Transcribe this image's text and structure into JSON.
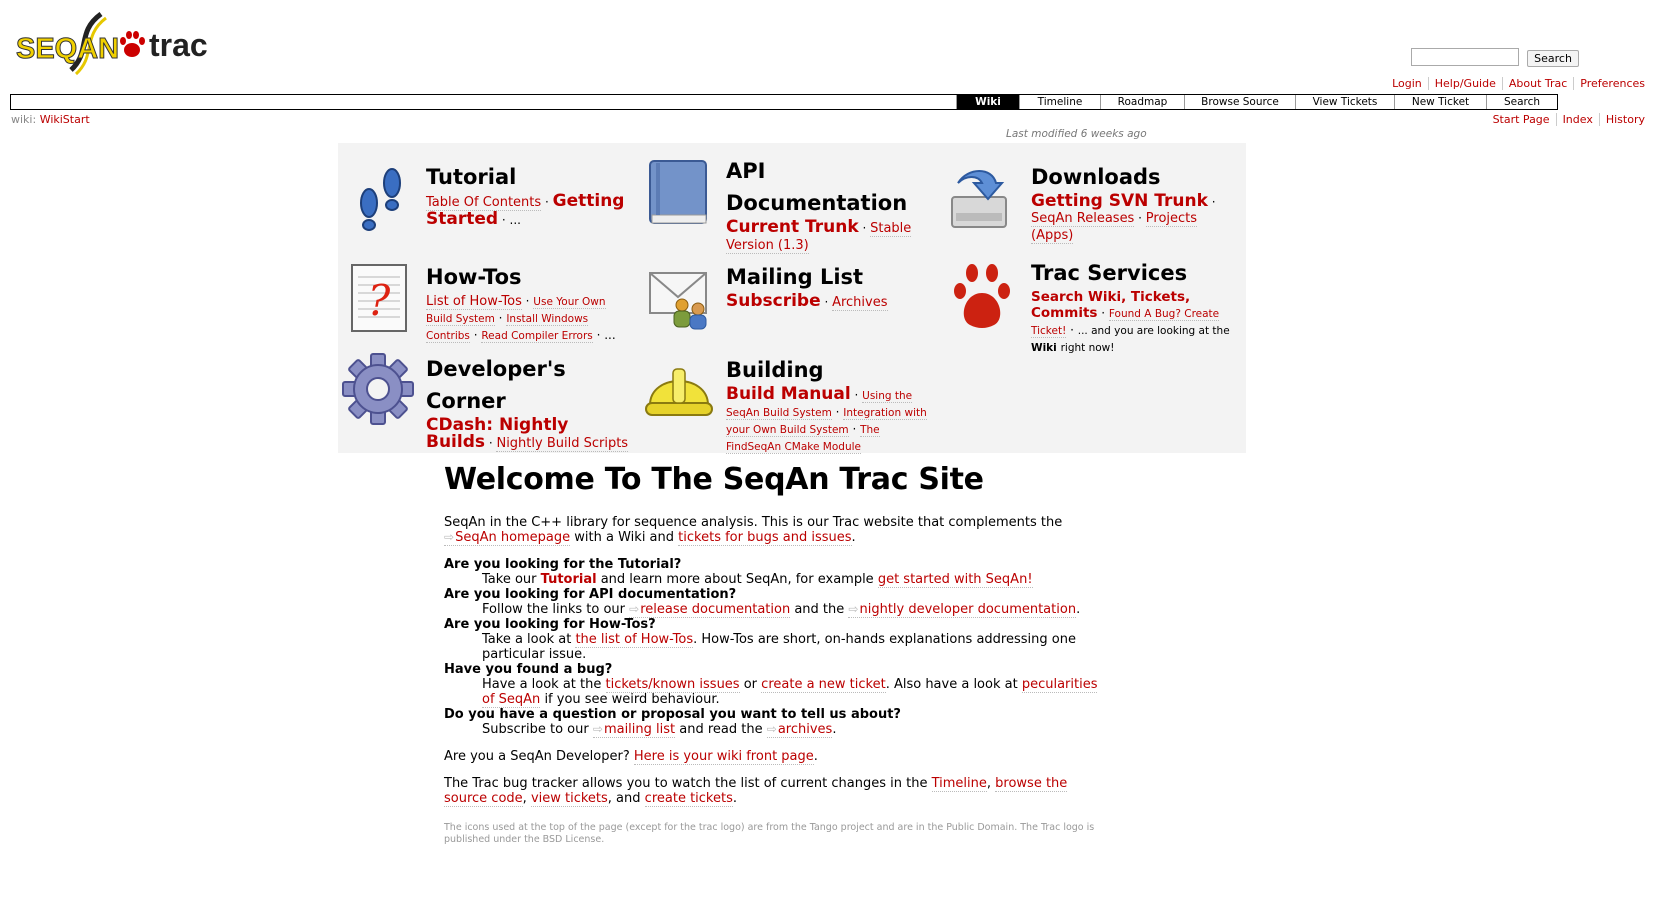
{
  "header": {
    "logo_text_left": "SEQAN",
    "logo_text_right": "trac",
    "search_placeholder": "",
    "search_button": "Search"
  },
  "metanav": [
    "Login",
    "Help/Guide",
    "About Trac",
    "Preferences"
  ],
  "mainnav": [
    "Wiki",
    "Timeline",
    "Roadmap",
    "Browse Source",
    "View Tickets",
    "New Ticket",
    "Search"
  ],
  "context": {
    "prefix": "wiki:",
    "page": "WikiStart",
    "nav": [
      "Start Page",
      "Index",
      "History"
    ],
    "last_modified": "Last modified 6 weeks ago"
  },
  "portal": {
    "tutorial": {
      "title": "Tutorial",
      "links": [
        "Table Of Contents",
        "Getting Started",
        "..."
      ]
    },
    "api": {
      "title_1": "API",
      "title_2": "Documentation",
      "links": [
        "Current Trunk",
        "Stable Version (1.3)"
      ]
    },
    "downloads": {
      "title": "Downloads",
      "links": [
        "Getting SVN Trunk",
        "SeqAn Releases",
        "Projects (Apps)"
      ]
    },
    "howtos": {
      "title": "How-Tos",
      "links": [
        "List of How-Tos",
        "Use Your Own Build System",
        "Install Windows Contribs",
        "Read Compiler Errors",
        "..."
      ]
    },
    "mailing": {
      "title": "Mailing List",
      "links": [
        "Subscribe",
        "Archives"
      ]
    },
    "trac": {
      "title": "Trac Services",
      "links": [
        "Search Wiki, Tickets, Commits",
        "Found A Bug? Create Ticket!"
      ],
      "text_1": "... and you are looking at the",
      "text_bold": "Wiki",
      "text_2": "right now!"
    },
    "dev": {
      "title_1": "Developer's",
      "title_2": "Corner",
      "links": [
        "CDash: Nightly Builds",
        "Nightly Build Scripts"
      ]
    },
    "building": {
      "title": "Building",
      "links": [
        "Build Manual",
        "Using the SeqAn Build System",
        "Integration with your Own Build System",
        "The FindSeqAn CMake Module"
      ]
    }
  },
  "main": {
    "title": "Welcome To The SeqAn Trac Site",
    "intro": {
      "t1": "SeqAn in the C++ library for sequence analysis. This is our Trac website that complements the",
      "l1": "SeqAn homepage",
      "t2": "with a Wiki and",
      "l2": "tickets for bugs and issues",
      "t3": "."
    },
    "faq": {
      "q1": "Are you looking for the Tutorial?",
      "a1_t1": "Take our",
      "a1_l1": "Tutorial",
      "a1_t2": "and learn more about SeqAn, for example",
      "a1_l2": "get started with SeqAn!",
      "q2": "Are you looking for API documentation?",
      "a2_t1": "Follow the links to our",
      "a2_l1": "release documentation",
      "a2_t2": "and the",
      "a2_l2": "nightly developer documentation",
      "a2_t3": ".",
      "q3": "Are you looking for How-Tos?",
      "a3_t1": "Take a look at",
      "a3_l1": "the list of How-Tos",
      "a3_t2": ". How-Tos are short, on-hands explanations addressing one particular issue.",
      "q4": "Have you found a bug?",
      "a4_t1": "Have a look at the",
      "a4_l1": "tickets/known issues",
      "a4_t2": "or",
      "a4_l2": "create a new ticket",
      "a4_t3": ". Also have a look at",
      "a4_l3": "pecularities of SeqAn",
      "a4_t4": "if you see weird behaviour.",
      "q5": "Do you have a question or proposal you want to tell us about?",
      "a5_t1": "Subscribe to our",
      "a5_l1": "mailing list",
      "a5_t2": "and read the",
      "a5_l2": "archives",
      "a5_t3": "."
    },
    "dev": {
      "t1": "Are you a SeqAn Developer?",
      "l1": "Here is your wiki front page",
      "t2": "."
    },
    "tracinfo": {
      "t1": "The Trac bug tracker allows you to watch the list of current changes in the",
      "l1": "Timeline",
      "t2": ",",
      "l2": "browse the source code",
      "t3": ",",
      "l3": "view tickets",
      "t4": ", and",
      "l4": "create tickets",
      "t5": "."
    },
    "footer": "The icons used at the top of the page (except for the trac logo) are from the Tango project and are in the Public Domain. The Trac logo is published under the BSD License."
  },
  "colors": {
    "link": "#bb0000",
    "portal_bg": "#f3f3f3",
    "active_tab": "#000000"
  }
}
